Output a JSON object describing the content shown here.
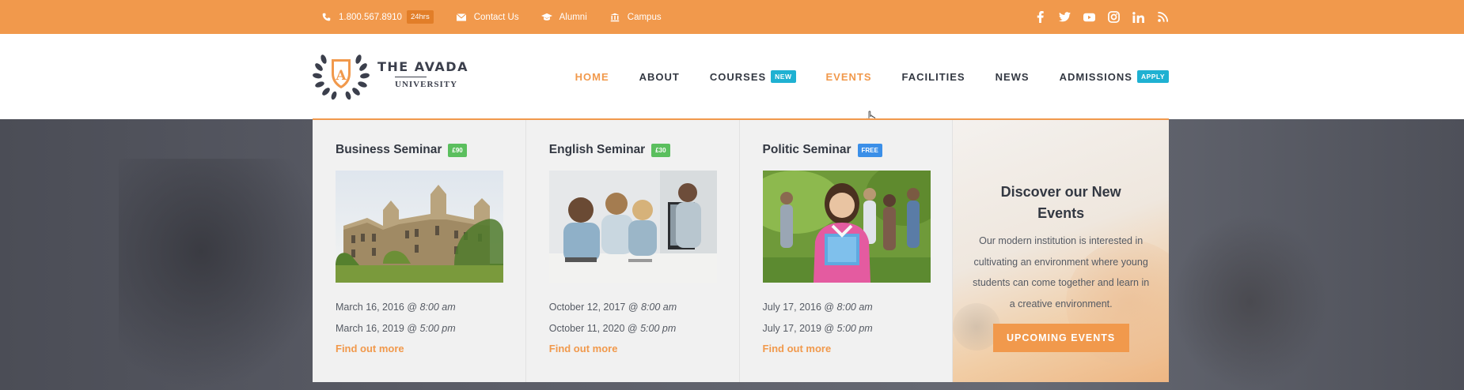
{
  "topbar": {
    "phone": "1.800.567.8910",
    "phone_badge": "24hrs",
    "contact": "Contact Us",
    "alumni": "Alumni",
    "campus": "Campus",
    "social": [
      "facebook-icon",
      "twitter-icon",
      "youtube-icon",
      "instagram-icon",
      "linkedin-icon",
      "rss-icon"
    ],
    "color": "#f1994c"
  },
  "logo": {
    "title": "THE AVADA",
    "subtitle": "UNIVERSITY",
    "letter": "A"
  },
  "nav": {
    "items": [
      {
        "label": "HOME",
        "state": "active"
      },
      {
        "label": "ABOUT"
      },
      {
        "label": "COURSES",
        "badge": "NEW"
      },
      {
        "label": "EVENTS",
        "state": "hover"
      },
      {
        "label": "FACILITIES"
      },
      {
        "label": "NEWS"
      },
      {
        "label": "ADMISSIONS",
        "badge": "APPLY"
      }
    ],
    "accent": "#f1994c",
    "badge_color": "#1fb1d2"
  },
  "mega": {
    "events": [
      {
        "title": "Business Seminar",
        "price": "£90",
        "price_color": "green",
        "image": "university-building-photo",
        "dates": [
          {
            "date": "March 16, 2016 @ ",
            "time": "8:00 am"
          },
          {
            "date": "March 16, 2019 @ ",
            "time": "5:00 pm"
          }
        ],
        "link": "Find out more"
      },
      {
        "title": "English Seminar",
        "price": "£30",
        "price_color": "green",
        "image": "students-at-computer-photo",
        "dates": [
          {
            "date": "October 12, 2017 @ ",
            "time": "8:00 am"
          },
          {
            "date": "October 11, 2020 @ ",
            "time": "5:00 pm"
          }
        ],
        "link": "Find out more"
      },
      {
        "title": "Politic Seminar",
        "price": "FREE",
        "price_color": "blue",
        "image": "student-with-folders-photo",
        "dates": [
          {
            "date": "July 17, 2016 @ ",
            "time": "8:00 am"
          },
          {
            "date": "July 17, 2019 @ ",
            "time": "5:00 pm"
          }
        ],
        "link": "Find out more"
      }
    ],
    "promo": {
      "title": "Discover our New Events",
      "text": "Our modern institution is interested in cultivating an environment where young students can come together and learn in a creative environment.",
      "button": "UPCOMING EVENTS"
    }
  }
}
